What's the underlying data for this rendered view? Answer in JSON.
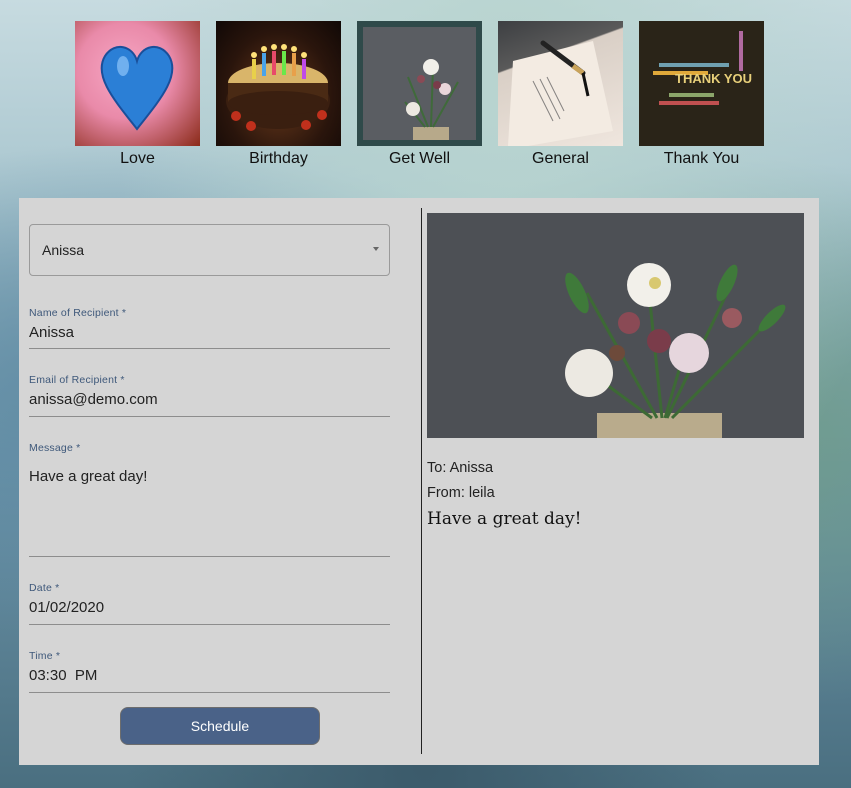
{
  "categories": [
    {
      "label": "Love",
      "icon": "heart-image"
    },
    {
      "label": "Birthday",
      "icon": "birthday-cake-image"
    },
    {
      "label": "Get Well",
      "icon": "flowers-image",
      "selected": true
    },
    {
      "label": "General",
      "icon": "pen-paper-image"
    },
    {
      "label": "Thank You",
      "icon": "thank-you-words-image"
    }
  ],
  "thank_you_image_text": "THANK YOU",
  "form": {
    "contact_select_value": "Anissa",
    "recipient_name_label": "Name of Recipient *",
    "recipient_name_value": "Anissa",
    "recipient_email_label": "Email of Recipient *",
    "recipient_email_value": "anissa@demo.com",
    "message_label": "Message *",
    "message_value": "Have a great day!",
    "date_label": "Date *",
    "date_value": "01/02/2020",
    "time_label": "Time *",
    "time_value": "03:30  PM",
    "schedule_label": "Schedule"
  },
  "preview": {
    "to_text": "To: Anissa",
    "from_text": "From: leila",
    "message_text": "Have a great day!"
  },
  "colors": {
    "panel_bg": "#d5d5d5",
    "label_color": "#3e587a",
    "button_bg": "#4a6288",
    "selected_border": "#2f4a4a"
  }
}
